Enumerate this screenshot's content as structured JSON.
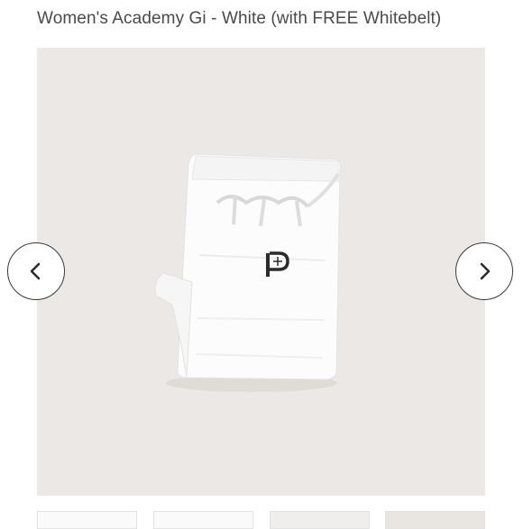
{
  "product": {
    "title": "Women's Academy Gi - White (with FREE Whitebelt)"
  },
  "gallery": {
    "background_color": "#ebe8e5",
    "item_color": "#ffffff",
    "logo_letter": "P",
    "prev_icon": "chevron-left-icon",
    "next_icon": "chevron-right-icon",
    "thumbnail_count": 4
  }
}
